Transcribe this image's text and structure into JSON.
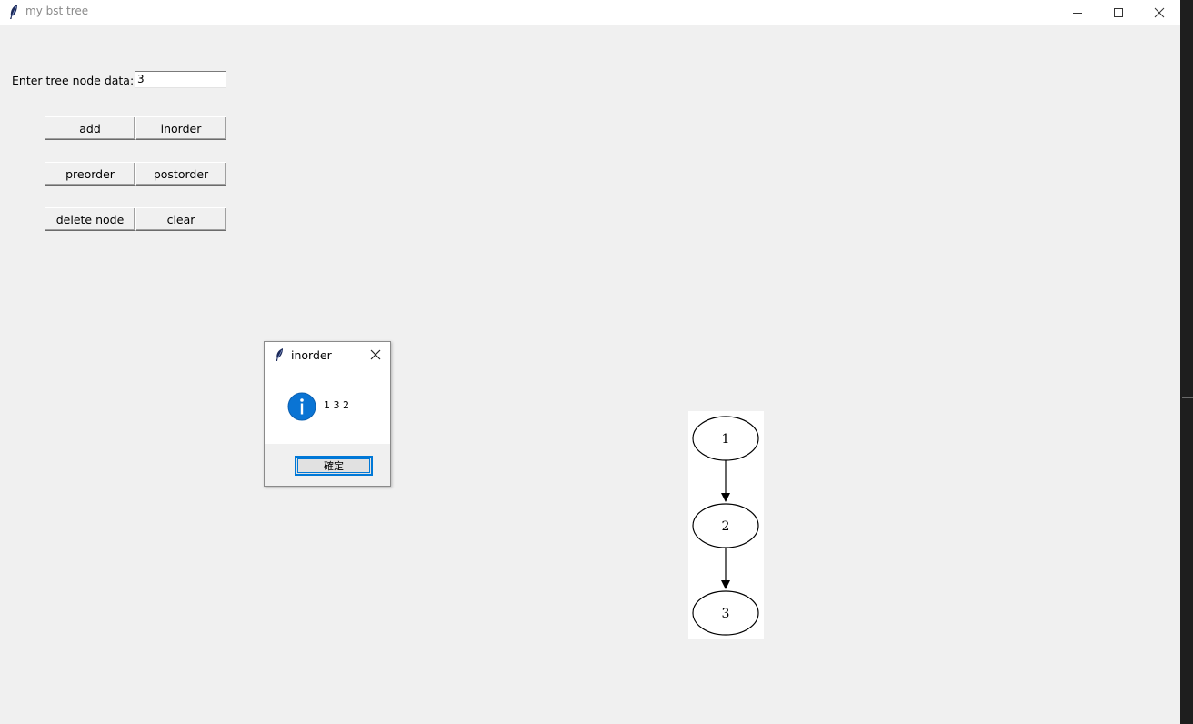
{
  "window": {
    "title": "my bst tree",
    "icon": "feather-icon",
    "controls": [
      "minimize-icon",
      "maximize-icon",
      "close-icon"
    ]
  },
  "form": {
    "entry_label": "Enter tree node data:",
    "entry_value": "3",
    "buttons": {
      "add": "add",
      "inorder": "inorder",
      "preorder": "preorder",
      "postorder": "postorder",
      "delete_node": "delete node",
      "clear": "clear"
    }
  },
  "dialog": {
    "title": "inorder",
    "icon": "info-icon",
    "message": "1 3 2",
    "ok_label": "確定"
  },
  "tree_graph": {
    "nodes": [
      "1",
      "2",
      "3"
    ],
    "edges": [
      [
        "1",
        "2"
      ],
      [
        "2",
        "3"
      ]
    ]
  },
  "colors": {
    "background": "#f0f0f0",
    "accent": "#0078d7"
  }
}
